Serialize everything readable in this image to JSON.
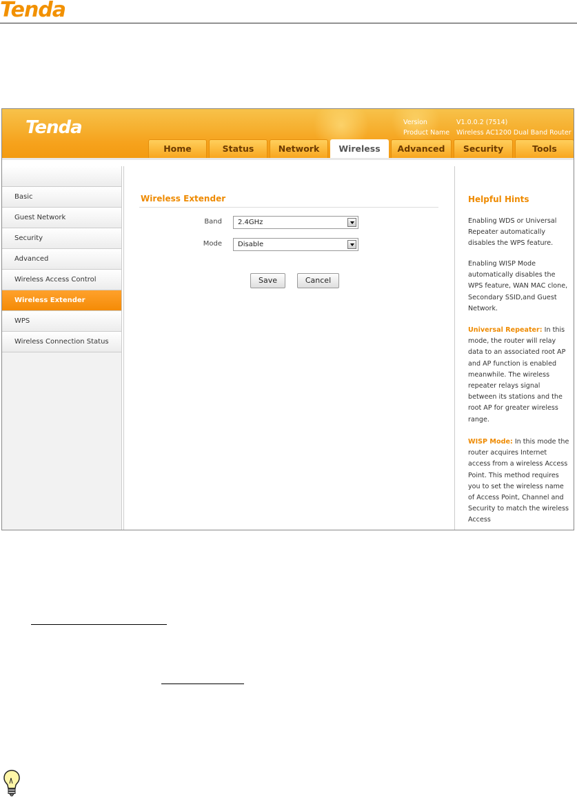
{
  "doc": {
    "logo": "Tenda"
  },
  "app": {
    "logo": "Tenda",
    "version_label": "Version",
    "version_value": "V1.0.0.2 (7514)",
    "product_label": "Product Name",
    "product_value": "Wireless AC1200 Dual Band Router"
  },
  "tabs": [
    "Home",
    "Status",
    "Network",
    "Wireless",
    "Advanced",
    "Security",
    "Tools"
  ],
  "active_tab": "Wireless",
  "sidebar": {
    "items": [
      "Basic",
      "Guest Network",
      "Security",
      "Advanced",
      "Wireless Access Control",
      "Wireless Extender",
      "WPS",
      "Wireless Connection Status"
    ],
    "active": "Wireless Extender"
  },
  "main": {
    "title": "Wireless Extender",
    "band_label": "Band",
    "band_value": "2.4GHz",
    "mode_label": "Mode",
    "mode_value": "Disable",
    "save_label": "Save",
    "cancel_label": "Cancel"
  },
  "hints": {
    "title": "Helpful Hints",
    "p1": "Enabling WDS or Universal Repeater automatically disables the WPS feature.",
    "p2": "Enabling WISP Mode automatically disables the WPS feature, WAN MAC clone, Secondary SSID,and Guest Network.",
    "p3_head": "Universal Repeater:",
    "p3_body": " In this mode, the router will relay data to an associated root AP and AP function is enabled meanwhile. The wireless repeater relays signal between its stations and the root AP for greater wireless range.",
    "p4_head": "WISP Mode:",
    "p4_body": " In this mode the router acquires Internet access from a wireless Access Point. This method requires you to set the wireless name of Access Point, Channel and Security to match the wireless Access"
  },
  "colors": {
    "accent": "#ee8a00",
    "header": "#f6a21c"
  }
}
